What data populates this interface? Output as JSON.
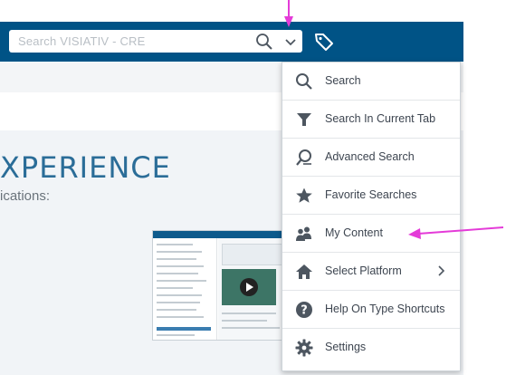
{
  "topbar": {
    "search_placeholder": "Search VISIATIV - CRE"
  },
  "icons": {
    "magnifier": "search-icon",
    "chevron": "chevron-down-icon",
    "tag": "tag-icon"
  },
  "background": {
    "hero_title": "XPERIENCE",
    "hero_subtitle": "ications:"
  },
  "menu": {
    "items": [
      {
        "label": "Search",
        "icon": "search-icon"
      },
      {
        "label": "Search In Current Tab",
        "icon": "filter-icon"
      },
      {
        "label": "Advanced Search",
        "icon": "advanced-search-icon"
      },
      {
        "label": "Favorite Searches",
        "icon": "star-icon"
      },
      {
        "label": "My Content",
        "icon": "users-icon"
      },
      {
        "label": "Select Platform",
        "icon": "home-icon",
        "submenu": true
      },
      {
        "label": "Help On Type Shortcuts",
        "icon": "help-icon"
      },
      {
        "label": "Settings",
        "icon": "gear-icon"
      }
    ]
  },
  "colors": {
    "topbar": "#005386",
    "accent_title": "#2b6d98",
    "annotation_arrow": "#e43bd8",
    "icon": "#4d5660"
  }
}
